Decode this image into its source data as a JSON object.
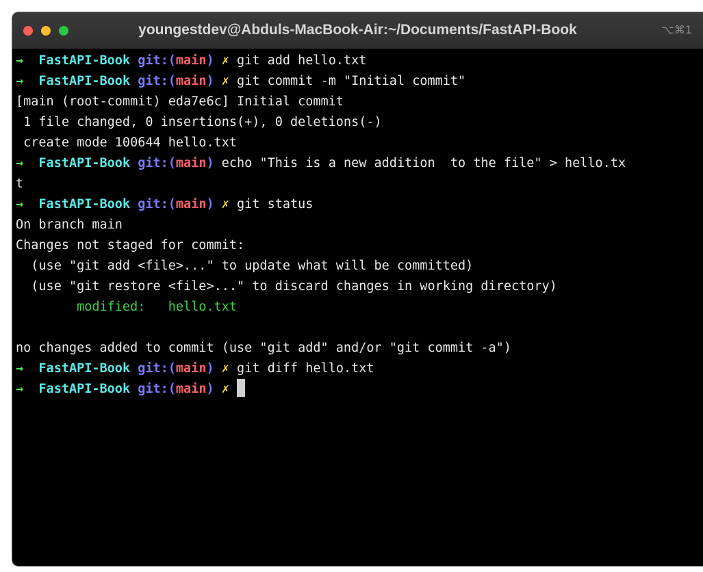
{
  "window": {
    "title": "youngestdev@Abduls-MacBook-Air:~/Documents/FastAPI-Book",
    "shortcut": "⌥⌘1"
  },
  "prompt": {
    "arrow": "→",
    "dir": "FastAPI-Book",
    "git_open": "git:(",
    "branch": "main",
    "git_close": ")",
    "dirty": "✗"
  },
  "commands": {
    "c1": "git add hello.txt",
    "c2": "git commit -m \"Initial commit\"",
    "c3": "echo \"This is a new addition  to the file\" > hello.tx",
    "c4": "git status",
    "c5": "git diff hello.txt"
  },
  "output": {
    "o1": "[main (root-commit) eda7e6c] Initial commit",
    "o2": " 1 file changed, 0 insertions(+), 0 deletions(-)",
    "o3": " create mode 100644 hello.txt",
    "o4": "t",
    "o5": "On branch main",
    "o6": "Changes not staged for commit:",
    "o7": "  (use \"git add <file>...\" to update what will be committed)",
    "o8": "  (use \"git restore <file>...\" to discard changes in working directory)",
    "o9_label": "modified:",
    "o9_file": "hello.txt",
    "o10": "no changes added to commit (use \"git add\" and/or \"git commit -a\")"
  },
  "colors": {
    "arrow": "#4ee54e",
    "dir": "#5ee8e8",
    "git": "#7a7aff",
    "branch": "#ff5f6a",
    "dirty": "#f5e04a",
    "modified": "#3fcf4a"
  }
}
